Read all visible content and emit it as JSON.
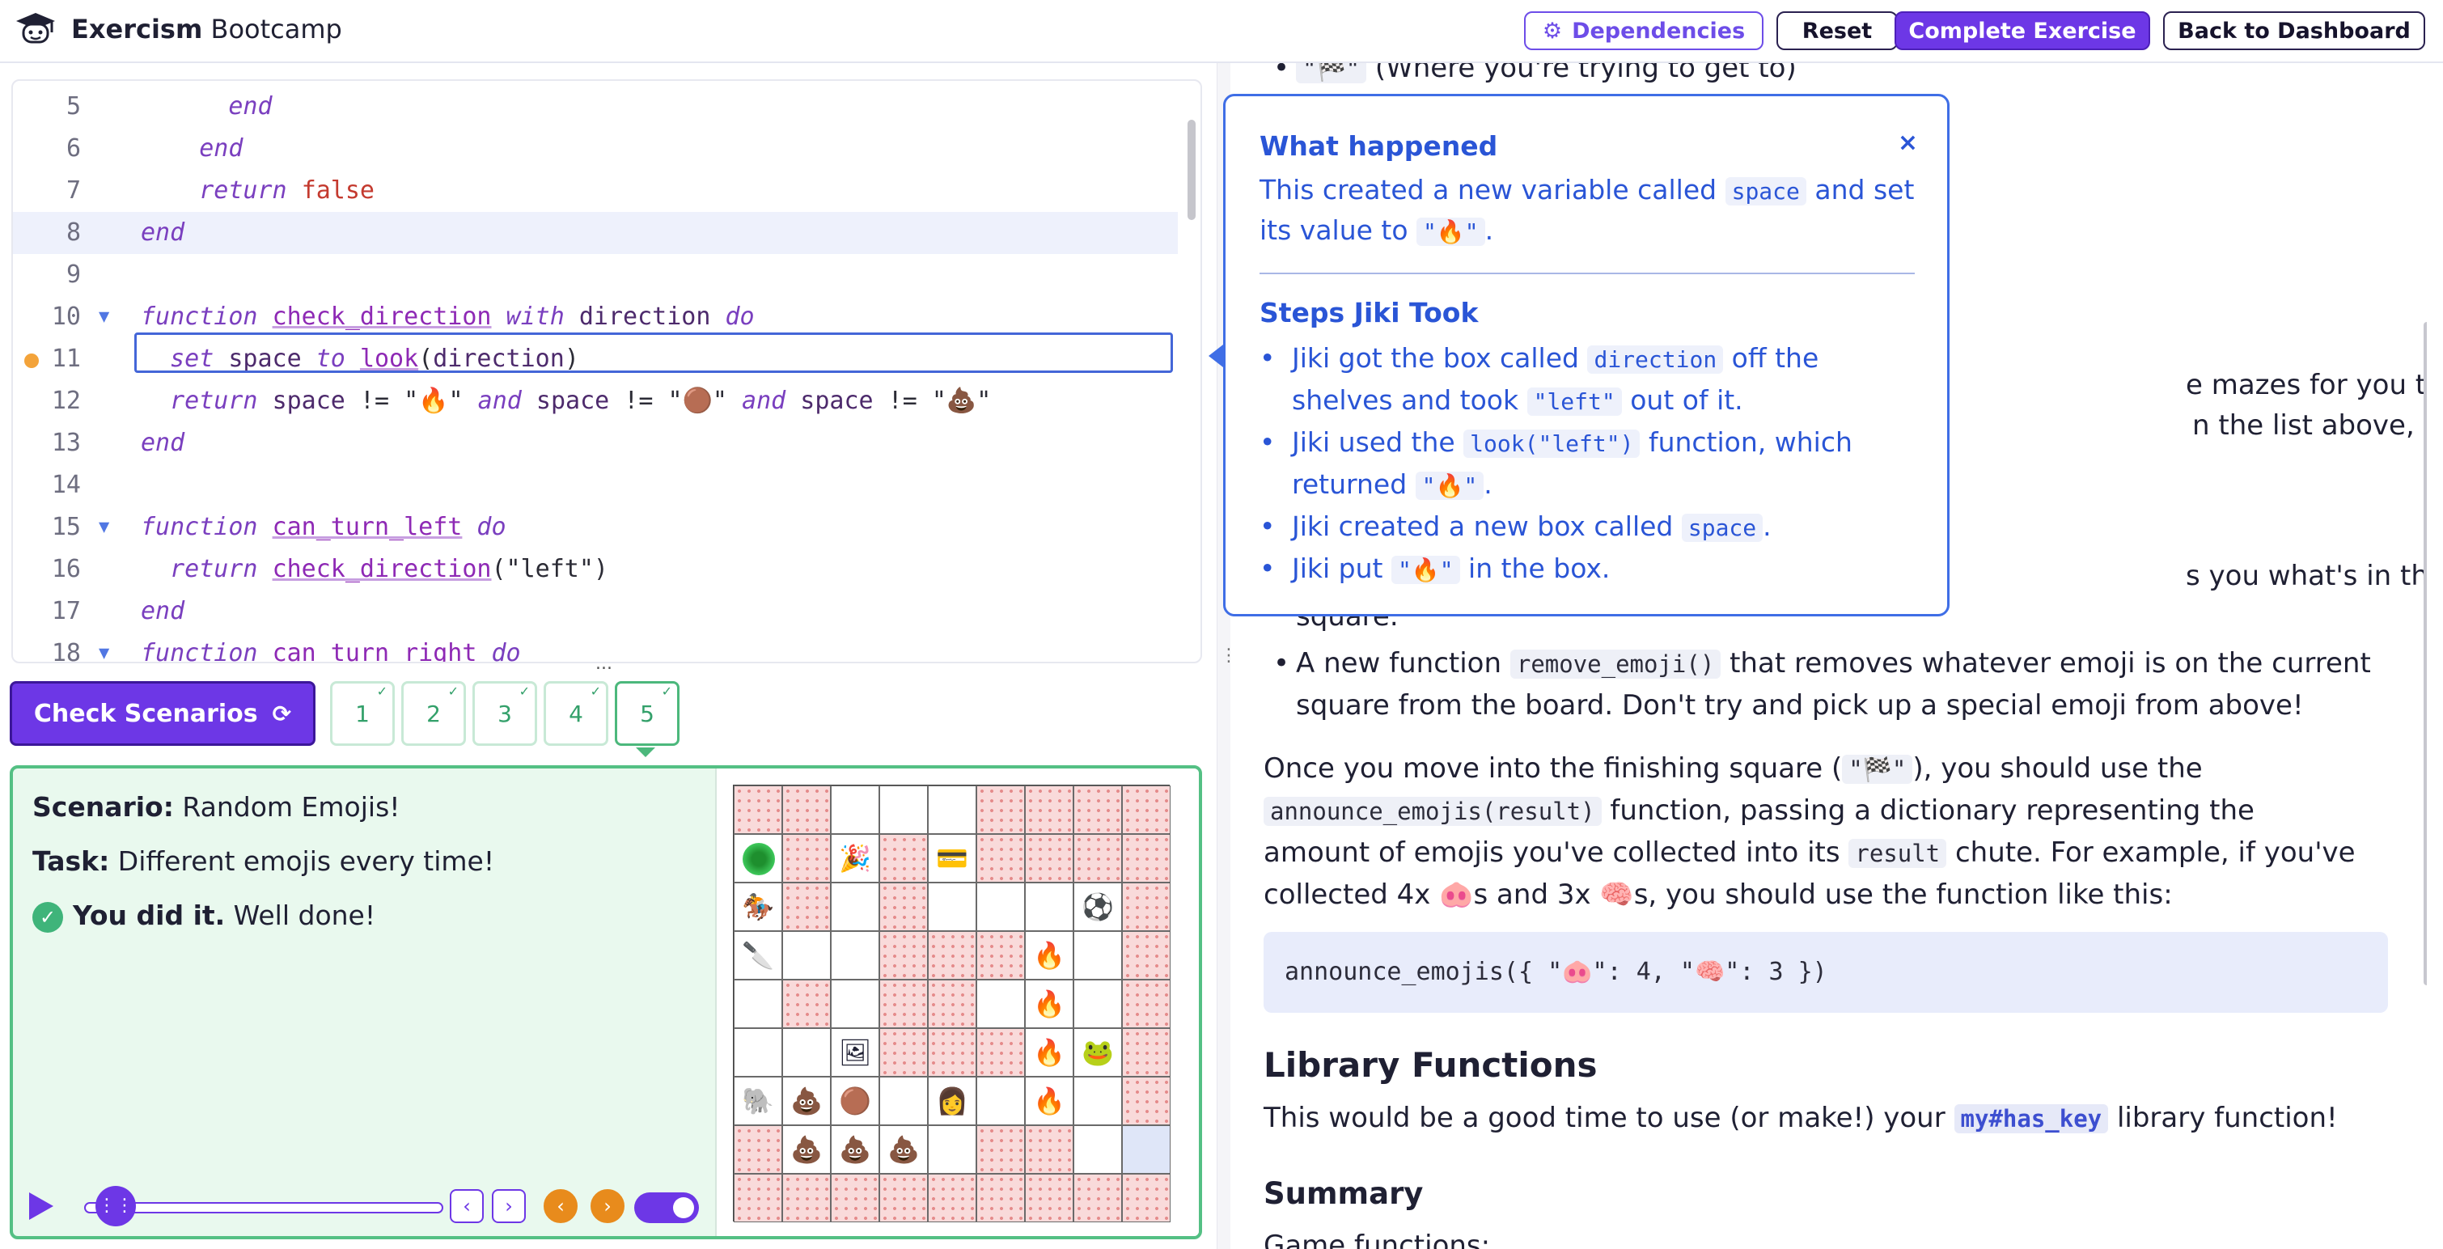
{
  "header": {
    "brand_bold": "Exercism",
    "brand_rest": " Bootcamp",
    "buttons": {
      "dependencies": "Dependencies",
      "reset": "Reset",
      "complete": "Complete Exercise",
      "back": "Back to Dashboard"
    }
  },
  "editor": {
    "lines": [
      {
        "n": "5",
        "tokens": [
          [
            "kw",
            "      end"
          ]
        ]
      },
      {
        "n": "6",
        "tokens": [
          [
            "kw",
            "    end"
          ]
        ]
      },
      {
        "n": "7",
        "tokens": [
          [
            "kw",
            "    return "
          ],
          [
            "lit",
            "false"
          ]
        ]
      },
      {
        "n": "8",
        "tokens": [
          [
            "kw",
            "end"
          ]
        ]
      },
      {
        "n": "9",
        "tokens": []
      },
      {
        "n": "10",
        "tokens": [
          [
            "kw",
            "function "
          ],
          [
            "fn",
            "check_direction"
          ],
          [
            "kw",
            " with "
          ],
          [
            "var",
            "direction"
          ],
          [
            "kw",
            " do"
          ]
        ]
      },
      {
        "n": "11",
        "tokens": [
          [
            "kw",
            "  set "
          ],
          [
            "var",
            "space"
          ],
          [
            "kw",
            " to "
          ],
          [
            "fn",
            "look"
          ],
          [
            "str",
            "("
          ],
          [
            "var",
            "direction"
          ],
          [
            "str",
            ")"
          ]
        ]
      },
      {
        "n": "12",
        "tokens": [
          [
            "kw",
            "  return "
          ],
          [
            "var",
            "space"
          ],
          [
            "str",
            " != \"🔥\" "
          ],
          [
            "kw",
            "and "
          ],
          [
            "var",
            "space"
          ],
          [
            "str",
            " != \"🟤\" "
          ],
          [
            "kw",
            "and "
          ],
          [
            "var",
            "space"
          ],
          [
            "str",
            " != \"💩\""
          ]
        ]
      },
      {
        "n": "13",
        "tokens": [
          [
            "kw",
            "end"
          ]
        ]
      },
      {
        "n": "14",
        "tokens": []
      },
      {
        "n": "15",
        "tokens": [
          [
            "kw",
            "function "
          ],
          [
            "fn",
            "can_turn_left"
          ],
          [
            "kw",
            " do"
          ]
        ]
      },
      {
        "n": "16",
        "tokens": [
          [
            "kw",
            "  return "
          ],
          [
            "fn",
            "check_direction"
          ],
          [
            "str",
            "(\"left\")"
          ]
        ]
      },
      {
        "n": "17",
        "tokens": [
          [
            "kw",
            "end"
          ]
        ]
      },
      {
        "n": "18",
        "tokens": [
          [
            "kw",
            "function "
          ],
          [
            "fn",
            "can_turn_right"
          ],
          [
            "kw",
            " do"
          ]
        ]
      }
    ]
  },
  "scenarios": {
    "check_label": "Check Scenarios",
    "tabs": [
      "1",
      "2",
      "3",
      "4",
      "5"
    ],
    "active_tab": "5",
    "more": "..."
  },
  "scenario_panel": {
    "scenario_label": "Scenario:",
    "scenario_value": " Random Emojis!",
    "task_label": "Task:",
    "task_value": " Different emojis every time!",
    "result_bold": "You did it.",
    "result_rest": " Well done!",
    "progress": 0.07
  },
  "board": {
    "rows": [
      [
        "W",
        "W",
        "",
        "",
        "",
        "W",
        "W",
        "W",
        "W"
      ],
      [
        "P",
        "W",
        "🎉",
        "W",
        "💳",
        "W",
        "W",
        "W",
        "W"
      ],
      [
        "🏇",
        "W",
        "",
        "W",
        "",
        "",
        "",
        "⚽",
        "W"
      ],
      [
        "🔪",
        "",
        "",
        "W",
        "W",
        "W",
        "🔥",
        "",
        "W"
      ],
      [
        "",
        "W",
        "",
        "W",
        "W",
        "",
        "🔥",
        "",
        "W"
      ],
      [
        "",
        "",
        "🖼",
        "W",
        "W",
        "W",
        "🔥",
        "🐸",
        "W"
      ],
      [
        "🐘",
        "💩",
        "🟤",
        "",
        "👩",
        "",
        "🔥",
        "",
        "W"
      ],
      [
        "W",
        "💩",
        "💩",
        "💩",
        "",
        "W",
        "W",
        "",
        "F"
      ],
      [
        "W",
        "W",
        "W",
        "W",
        "W",
        "W",
        "W",
        "W",
        "W"
      ]
    ]
  },
  "instructions": {
    "top_bullet_code": "\"🏁\"",
    "top_bullet_text": " (Where you're trying to get to)",
    "partial1": "e mazes for you to pick up.",
    "partial2": "n the list above, it should add it",
    "partial3": "s you what's in the current",
    "partial4": "square.",
    "bullet_remove_pre": "A new function ",
    "bullet_remove_code": "remove_emoji()",
    "bullet_remove_post": " that removes whatever emoji is on the current",
    "bullet_remove_line2": "square from the board. Don't try and pick up a special emoji from above!",
    "para1_a": "Once you move into the finishing square (",
    "para1_code": "\"🏁\"",
    "para1_b": "), you should use the",
    "para2_code": "announce_emojis(result)",
    "para2_b": " function, passing a dictionary representing the",
    "para3_a": "amount of emojis you've collected into its ",
    "para3_code": "result",
    "para3_b": " chute. For example, if you've",
    "para4": "collected 4x 🐽s and 3x 🧠s, you should use the function like this:",
    "codeblock": "announce_emojis({ \"🐽\": 4, \"🧠\": 3 })",
    "lib_heading": "Library Functions",
    "lib_a": "This would be a good time to use (or make!) your ",
    "lib_code": "my#has_key",
    "lib_b": " library function!",
    "summary_heading": "Summary",
    "summary_sub": "Game functions:"
  },
  "popover": {
    "title": "What happened",
    "close": "×",
    "l1_a": "This created a new variable called ",
    "l1_code": "space",
    "l1_b": " and set",
    "l2_a": "its value to ",
    "l2_code": "\"🔥\"",
    "l2_b": ".",
    "steps_title": "Steps Jiki Took",
    "s1_a": "Jiki got the box called ",
    "s1_code": "direction",
    "s1_b": " off the",
    "s1_l2_a": "shelves and took ",
    "s1_l2_code": "\"left\"",
    "s1_l2_b": " out of it.",
    "s2_a": "Jiki used the ",
    "s2_code": "look(\"left\")",
    "s2_b": " function, which",
    "s2_l2_a": "returned ",
    "s2_l2_code": "\"🔥\"",
    "s2_l2_b": ".",
    "s3_a": "Jiki created a new box called ",
    "s3_code": "space",
    "s3_b": ".",
    "s4_a": "Jiki put ",
    "s4_code": "\"🔥\"",
    "s4_b": " in the box."
  }
}
